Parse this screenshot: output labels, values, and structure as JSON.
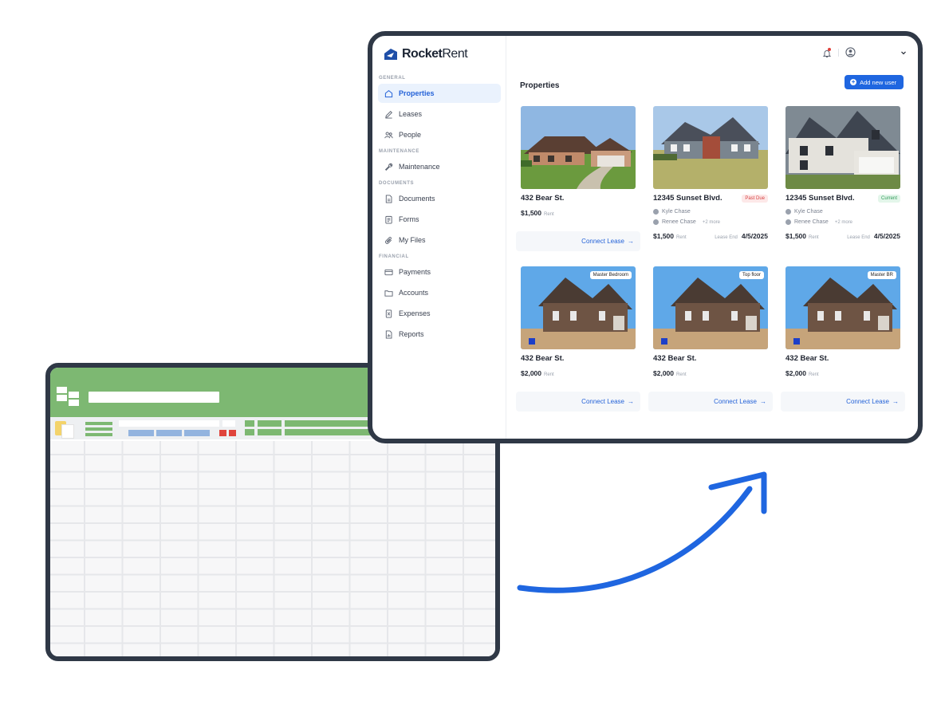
{
  "app": {
    "brand_bold": "Rocket",
    "brand_light": "Rent",
    "page_title": "Properties",
    "add_button_label": "Add new user"
  },
  "sidebar": {
    "sections": [
      {
        "label": "GENERAL",
        "items": [
          {
            "label": "Properties",
            "icon": "home-icon",
            "active": true
          },
          {
            "label": "Leases",
            "icon": "pen-icon"
          },
          {
            "label": "People",
            "icon": "people-icon"
          }
        ]
      },
      {
        "label": "MAINTENANCE",
        "items": [
          {
            "label": "Maintenance",
            "icon": "wrench-icon"
          }
        ]
      },
      {
        "label": "DOCUMENTS",
        "items": [
          {
            "label": "Documents",
            "icon": "document-icon"
          },
          {
            "label": "Forms",
            "icon": "forms-icon"
          },
          {
            "label": "My Files",
            "icon": "paperclip-icon"
          }
        ]
      },
      {
        "label": "FINANCIAL",
        "items": [
          {
            "label": "Payments",
            "icon": "card-icon"
          },
          {
            "label": "Accounts",
            "icon": "folder-icon"
          },
          {
            "label": "Expenses",
            "icon": "receipt-icon"
          },
          {
            "label": "Reports",
            "icon": "report-icon"
          }
        ]
      }
    ]
  },
  "properties": [
    {
      "title": "432 Bear St.",
      "price": "$1,500",
      "price_unit": "Rent",
      "action": "Connect Lease"
    },
    {
      "title": "12345 Sunset Blvd.",
      "status": "Past Due",
      "tenants": [
        "Kyle Chase",
        "Renee Chase"
      ],
      "more": "+2 more",
      "price": "$1,500",
      "price_unit": "Rent",
      "lease_end_label": "Lease End",
      "lease_end": "4/5/2025"
    },
    {
      "title": "12345 Sunset Blvd.",
      "status": "Current",
      "tenants": [
        "Kyle Chase",
        "Renee Chase"
      ],
      "more": "+2 more",
      "price": "$1,500",
      "price_unit": "Rent",
      "lease_end_label": "Lease End",
      "lease_end": "4/5/2025"
    },
    {
      "title": "432 Bear St.",
      "tag": "Master Bedroom",
      "price": "$2,000",
      "price_unit": "Rent",
      "action": "Connect Lease"
    },
    {
      "title": "432 Bear St.",
      "tag": "Top floor",
      "price": "$2,000",
      "price_unit": "Rent",
      "action": "Connect Lease"
    },
    {
      "title": "432 Bear St.",
      "tag": "Master BR",
      "price": "$2,000",
      "price_unit": "Rent",
      "action": "Connect Lease"
    }
  ],
  "colors": {
    "accent": "#1f66e0",
    "sheet_green": "#7db872",
    "frame": "#2f3846",
    "status_due": "#d64545",
    "status_current": "#2f9a58"
  }
}
